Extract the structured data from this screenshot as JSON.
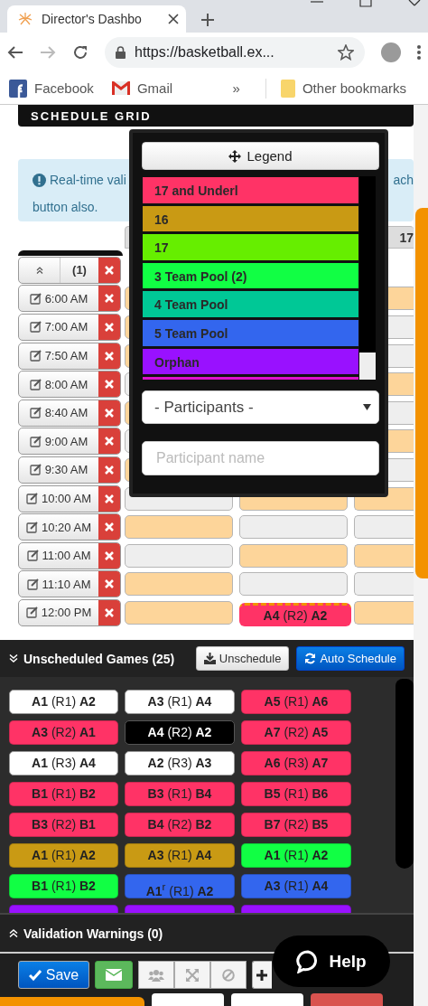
{
  "browser": {
    "tab": {
      "title": "Director's Dashbo",
      "selected": true
    },
    "address": "https://basketball.ex...",
    "bookmarks": [
      {
        "label": "Facebook",
        "kind": "social"
      },
      {
        "label": "Gmail",
        "kind": "mail"
      }
    ],
    "overflow": "»",
    "other_bookmarks": "Other bookmarks"
  },
  "page": {
    "title": "SCHEDULE GRID",
    "alert": {
      "left": "Real-time vali",
      "right": "ach",
      "second_line": "button also."
    },
    "column_headers": [
      "17"
    ],
    "grid": {
      "count": "(1)",
      "rows": [
        {
          "time": "6:00 AM",
          "slots": {
            "col_1": {
              "shaded": true
            },
            "col_3": {
              "shaded": true
            }
          }
        },
        {
          "time": "7:00 AM",
          "slots": {
            "col_1": {
              "shaded": true
            },
            "col_3": {
              "shaded": false
            }
          }
        },
        {
          "time": "7:50 AM",
          "slots": {
            "col_1": {
              "shaded": true
            },
            "col_3": {
              "shaded": false
            }
          }
        },
        {
          "time": "8:00 AM",
          "slots": {
            "col_1": {
              "shaded": false
            },
            "col_3": {
              "shaded": true
            }
          }
        },
        {
          "time": "8:40 AM",
          "slots": {
            "col_1": {
              "shaded": true
            },
            "col_3": {
              "shaded": false
            }
          }
        },
        {
          "time": "9:00 AM",
          "slots": {
            "col_1": {
              "shaded": false
            },
            "col_3": {
              "shaded": true
            }
          }
        },
        {
          "time": "9:30 AM",
          "slots": {
            "col_1": {
              "shaded": true
            },
            "col_3": {
              "shaded": false
            }
          }
        },
        {
          "time": "10:00 AM",
          "slots": {
            "col_1": {
              "shaded": false
            },
            "col_2": {
              "shaded": true
            },
            "col_3": {
              "shaded": true
            }
          }
        },
        {
          "time": "10:20 AM",
          "slots": {
            "col_1": {
              "shaded": true
            },
            "col_2": {
              "shaded": false
            },
            "col_3": {
              "shaded": false
            }
          }
        },
        {
          "time": "11:00 AM",
          "slots": {
            "col_1": {
              "shaded": false
            },
            "col_2": {
              "shaded": true
            },
            "col_3": {
              "shaded": true
            }
          }
        },
        {
          "time": "11:10 AM",
          "slots": {
            "col_1": {
              "shaded": true
            },
            "col_2": {
              "shaded": false
            },
            "col_3": {
              "shaded": false
            }
          }
        },
        {
          "time": "12:00 PM",
          "slots": {
            "col_1": {
              "shaded": true
            },
            "col_2": {
              "game": {
                "text": "**A4** (R2) **A2**",
                "color": "#ff3366"
              }
            },
            "col_3": {
              "shaded": true
            }
          }
        }
      ]
    }
  },
  "legend": {
    "button": "Legend",
    "items": [
      {
        "label": "17 and Underl",
        "color": "#ff3366"
      },
      {
        "label": "16",
        "color": "#c99a14"
      },
      {
        "label": "17",
        "color": "#66ee00"
      },
      {
        "label": "3 Team Pool (2)",
        "color": "#11ff44"
      },
      {
        "label": "4 Team Pool",
        "color": "#00c896"
      },
      {
        "label": "5 Team Pool",
        "color": "#3366ee"
      },
      {
        "label": "Orphan",
        "color": "#9911ff"
      },
      {
        "color": "#dd11cc"
      }
    ],
    "participants_select": "- Participants -",
    "participant_placeholder": "Participant name"
  },
  "unscheduled": {
    "title": "Unscheduled Games (25)",
    "expanded": true,
    "buttons": [
      {
        "label": "Unschedule",
        "kind": "default"
      },
      {
        "label": "Auto Schedule",
        "kind": "primary"
      }
    ],
    "games": [
      {
        "text": "**A1** (R1) **A2**",
        "placed": true,
        "selected": false
      },
      {
        "text": "**A3** (R1) **A4**",
        "placed": true,
        "selected": false
      },
      {
        "text": "**A5** (R1) **A6**",
        "color": "#ff3366",
        "placed": false,
        "selected": false
      },
      {
        "text": "**A3** (R2) **A1**",
        "color": "#ff3366",
        "placed": false,
        "selected": false
      },
      {
        "text": "**A4** (R2) **A2**",
        "placed": false,
        "selected": true
      },
      {
        "text": "**A7** (R2) **A5**",
        "color": "#ff3366",
        "placed": false,
        "selected": false
      },
      {
        "text": "**A1** (R3) **A4**",
        "placed": true,
        "selected": false
      },
      {
        "text": "**A2** (R3) **A3**",
        "placed": true,
        "selected": false
      },
      {
        "text": "**A6** (R3) **A7**",
        "color": "#ff3366",
        "placed": false,
        "selected": false
      },
      {
        "text": "**B1** (R1) **B2**",
        "color": "#ff3366",
        "placed": false,
        "selected": false
      },
      {
        "text": "**B3** (R1) **B4**",
        "color": "#ff3366",
        "placed": false,
        "selected": false
      },
      {
        "text": "**B5** (R1) **B6**",
        "color": "#ff3366",
        "placed": false,
        "selected": false
      },
      {
        "text": "**B3** (R2) **B1**",
        "color": "#ff3366",
        "placed": false,
        "selected": false
      },
      {
        "text": "**B4** (R2) **B2**",
        "color": "#ff3366",
        "placed": false,
        "selected": false
      },
      {
        "text": "**B7** (R2) **B5**",
        "color": "#ff3366",
        "placed": false,
        "selected": false
      },
      {
        "text": "**A1** (R1) **A2**",
        "color": "#c99a14",
        "placed": false,
        "selected": false
      },
      {
        "text": "**A3** (R1) **A4**",
        "color": "#c99a14",
        "placed": false,
        "selected": false
      },
      {
        "text": "**A1** (R1) **A2**",
        "color": "#11ff44",
        "placed": false,
        "selected": false
      },
      {
        "text": "**B1** (R1) **B2**",
        "color": "#11ff44",
        "placed": false,
        "selected": false
      },
      {
        "text": "**A1**$^{r}$ (R1) **A2**",
        "color": "#3366ee",
        "placed": false,
        "selected": false
      },
      {
        "text": "**A3** (R1) **A4**",
        "color": "#3366ee",
        "placed": false,
        "selected": false
      },
      {
        "color": "#9911ff",
        "placed": false,
        "selected": false
      },
      {
        "color": "#9911ff",
        "placed": false,
        "selected": false
      },
      {
        "color": "#9911ff",
        "placed": false,
        "selected": false
      }
    ]
  },
  "validation": {
    "title": "Validation Warnings (0)",
    "expanded": false
  },
  "toolbar": {
    "save": "Save"
  },
  "help": "Help"
}
